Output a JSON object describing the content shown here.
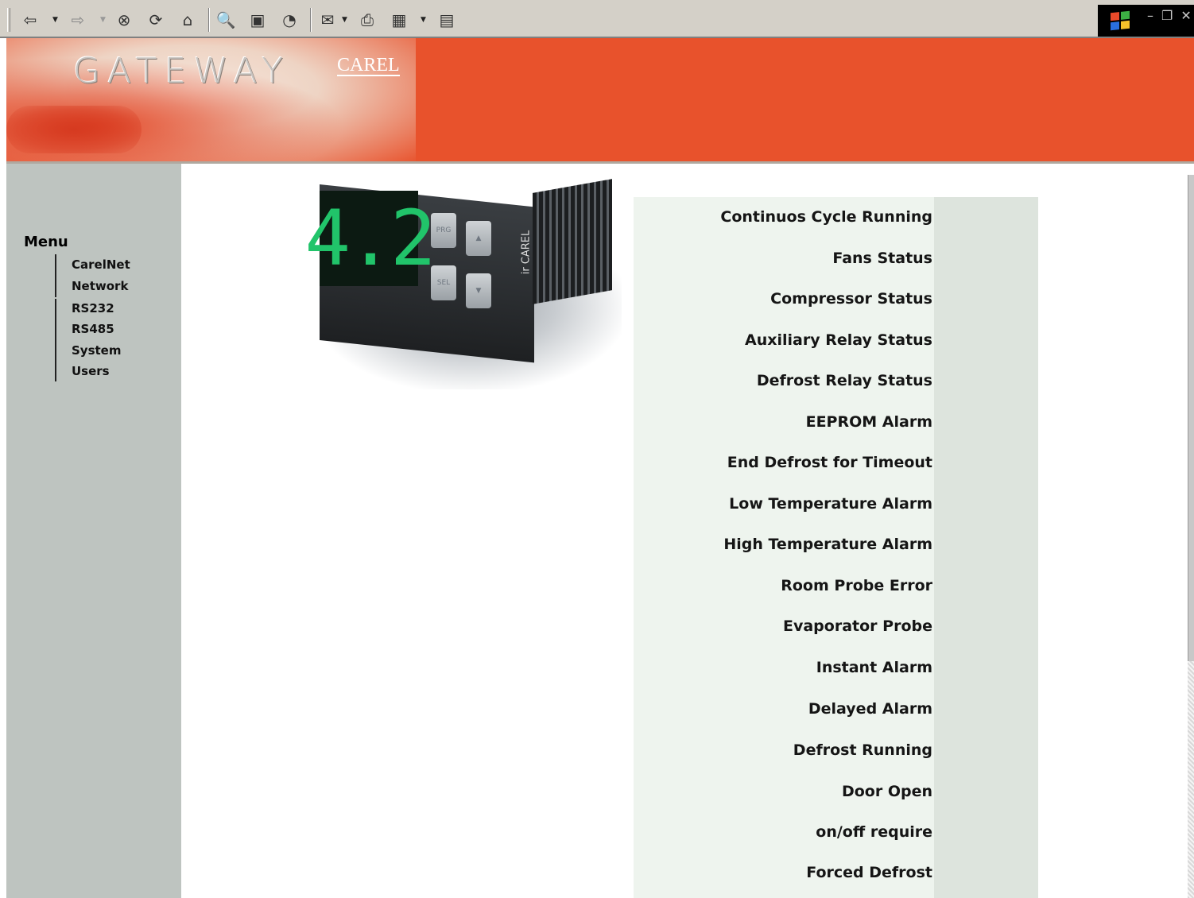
{
  "toolbar": {
    "buttons": [
      "back-icon",
      "forward-icon",
      "stop-icon",
      "refresh-icon",
      "home-icon",
      "search-icon",
      "favorites-icon",
      "history-icon",
      "mail-icon",
      "print-icon",
      "edit-icon",
      "discuss-icon"
    ]
  },
  "banner": {
    "title": "GATEWAY",
    "brand": "CAREL"
  },
  "device": {
    "display_value": "4.2",
    "button_prg": "PRG",
    "button_sel": "SEL",
    "brand": "ir CAREL"
  },
  "menu": {
    "title": "Menu",
    "items": [
      "CarelNet",
      "Network",
      "RS232",
      "RS485",
      "System",
      "Users"
    ]
  },
  "status": {
    "labels": [
      "Continuos Cycle Running",
      "Fans Status",
      "Compressor Status",
      "Auxiliary Relay Status",
      "Defrost Relay Status",
      "EEPROM Alarm",
      "End Defrost for Timeout",
      "Low Temperature Alarm",
      "High Temperature Alarm",
      "Room Probe Error",
      "Evaporator Probe",
      "Instant Alarm",
      "Delayed Alarm",
      "Defrost Running",
      "Door Open",
      "on/off require",
      "Forced Defrost"
    ]
  },
  "colors": {
    "banner": "#e8522c",
    "sidebar": "#bec4c0",
    "panel": "#eef4ee",
    "panel_column": "#dde4dd",
    "lcd_digits": "#21c46a"
  }
}
